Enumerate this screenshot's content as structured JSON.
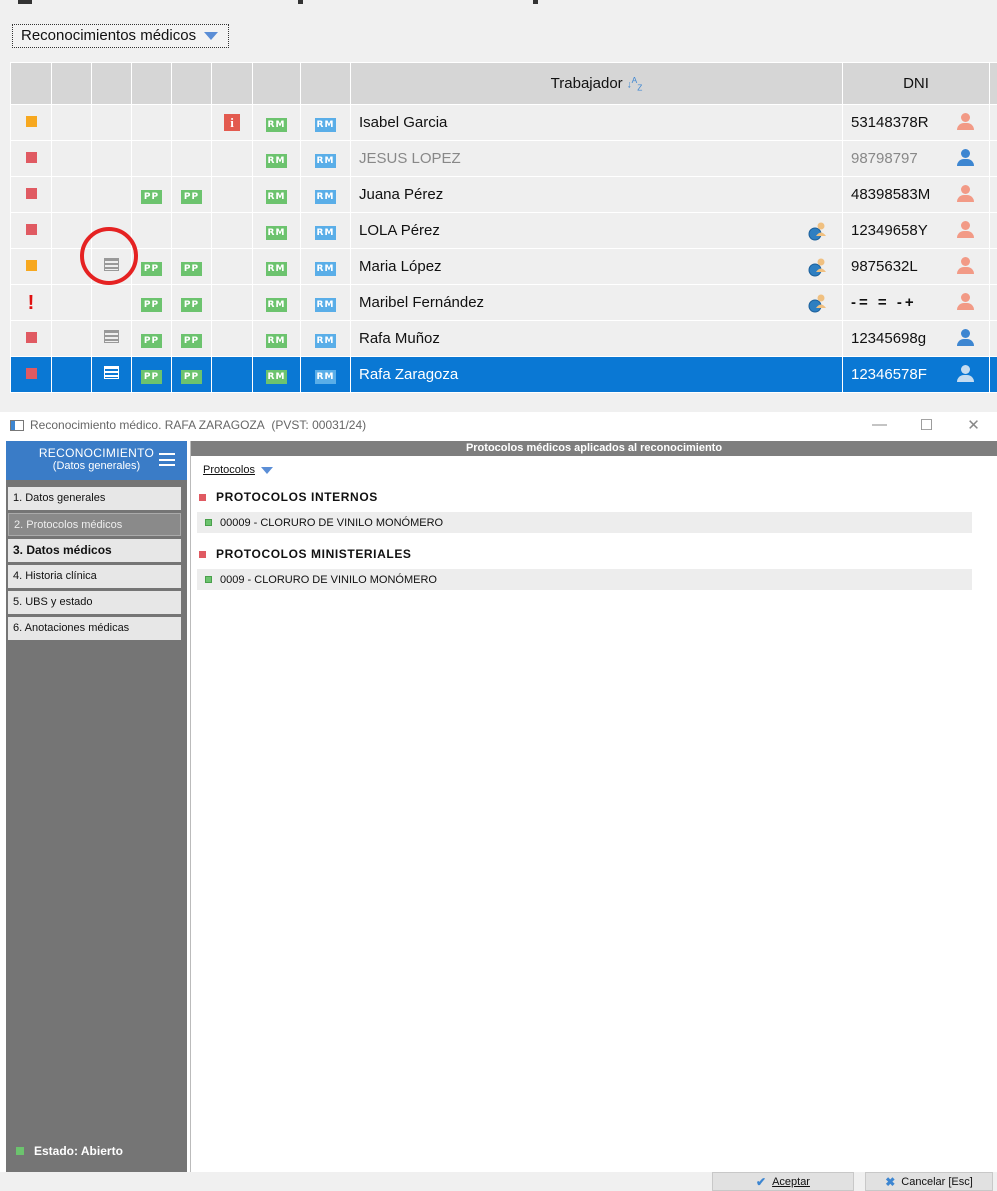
{
  "top_toolbar": {
    "dropdown_label": "Reconocimientos médicos"
  },
  "grid": {
    "header_worker": "Trabajador",
    "header_dni": "DNI",
    "tag_pp": "PP",
    "tag_rm": "RM",
    "info_glyph": "i",
    "rows": [
      {
        "name": "Isabel Garcia",
        "dni": "53148378R",
        "status": "orange",
        "info": true,
        "list": false,
        "pp": false,
        "globe": false,
        "person": "female",
        "grey": false
      },
      {
        "name": "JESUS LOPEZ",
        "dni": "98798797",
        "status": "red",
        "info": false,
        "list": false,
        "pp": false,
        "globe": false,
        "person": "male",
        "grey": true
      },
      {
        "name": "Juana Pérez",
        "dni": "48398583M",
        "status": "red",
        "info": false,
        "list": false,
        "pp": true,
        "globe": false,
        "person": "female",
        "grey": false
      },
      {
        "name": "LOLA Pérez",
        "dni": "12349658Y",
        "status": "red",
        "info": false,
        "list": false,
        "pp": false,
        "globe": true,
        "person": "female",
        "grey": false
      },
      {
        "name": "Maria López",
        "dni": "9875632L",
        "status": "orange",
        "info": false,
        "list": true,
        "pp": true,
        "globe": true,
        "person": "female",
        "grey": false
      },
      {
        "name": "Maribel Fernández",
        "dni": "-= = -+",
        "status": "excl",
        "info": false,
        "list": false,
        "pp": true,
        "globe": true,
        "person": "female",
        "grey": false
      },
      {
        "name": "Rafa Muñoz",
        "dni": "12345698g",
        "status": "red",
        "info": false,
        "list": true,
        "pp": true,
        "globe": false,
        "person": "male",
        "grey": false
      },
      {
        "name": "Rafa Zaragoza",
        "dni": "12346578F",
        "status": "red",
        "info": false,
        "list": true,
        "pp": true,
        "globe": false,
        "person": "male",
        "grey": false,
        "selected": true
      }
    ]
  },
  "dialog": {
    "title": "Reconocimiento médico. RAFA ZARAGOZA",
    "title_code": "(PVST: 00031/24)",
    "sidebar": {
      "header_title": "RECONOCIMIENTO",
      "header_sub": "(Datos generales)",
      "items": [
        {
          "label": "1. Datos generales"
        },
        {
          "label": "2. Protocolos médicos"
        },
        {
          "label": "3. Datos médicos"
        },
        {
          "label": "4. Historia clínica"
        },
        {
          "label": "5. UBS y estado"
        },
        {
          "label": "6. Anotaciones médicas"
        }
      ],
      "status": "Estado: Abierto"
    },
    "main": {
      "header": "Protocolos médicos aplicados al reconocimiento",
      "dropdown_label": "Protocolos",
      "sections": [
        {
          "title": "PROTOCOLOS INTERNOS",
          "items": [
            "00009 - CLORURO DE VINILO MONÓMERO"
          ]
        },
        {
          "title": "PROTOCOLOS MINISTERIALES",
          "items": [
            "0009 - CLORURO DE VINILO MONÓMERO"
          ]
        }
      ]
    },
    "buttons": {
      "accept": "Aceptar",
      "cancel": "Cancelar [Esc]"
    }
  },
  "colors": {
    "accent": "#0a78d4",
    "orange": "#f7a81f",
    "red": "#e05a62",
    "green": "#6cc36e",
    "blue": "#3d86d1"
  }
}
